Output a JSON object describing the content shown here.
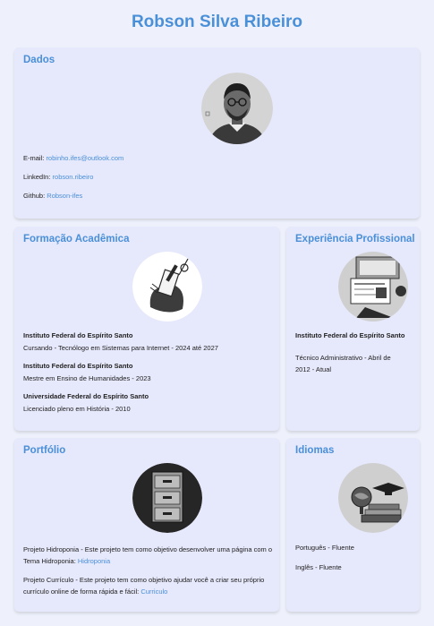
{
  "header": {
    "name": "Robson Silva Ribeiro"
  },
  "dados": {
    "title": "Dados",
    "email_label": "E-mail:",
    "email_value": "robinho.ifes@outlook.com",
    "linkedin_label": "LinkedIn:",
    "linkedin_value": "robson.ribeiro",
    "github_label": "Github:",
    "github_value": "Robson-ifes"
  },
  "formacao": {
    "title": "Formação Acadêmica",
    "items": [
      {
        "institution": "Instituto Federal do Espírito Santo",
        "detail": "Cursando - Tecnólogo em Sistemas para Internet - 2024 até 2027"
      },
      {
        "institution": "Instituto Federal do Espírito Santo",
        "detail": "Mestre em Ensino de Humanidades - 2023"
      },
      {
        "institution": "Universidade Federal do Espírito Santo",
        "detail": "Licenciado pleno em História - 2010"
      }
    ]
  },
  "experiencia": {
    "title": "Experiência Profissional",
    "institution": "Instituto Federal do Espírito Santo",
    "detail": "Técnico Administrativo - Abril de 2012 - Atual"
  },
  "portfolio": {
    "title": "Portfólio",
    "project1_text": "Projeto Hidroponia - Este projeto tem como objetivo desenvolver uma página com o Tema Hidroponia:",
    "project1_link": "Hidroponia",
    "project2_text": "Projeto Currículo - Este projeto tem como objetivo ajudar você a criar seu próprio currículo online de forma rápida e fácil:",
    "project2_link": "Curriculo"
  },
  "idiomas": {
    "title": "Idiomas",
    "items": [
      "Português - Fluente",
      "Inglês - Fluente"
    ]
  },
  "colors": {
    "accent": "#4a90d9",
    "card": "#e6e8fb",
    "background": "#eef1fb"
  },
  "icons": [
    "profile-avatar",
    "education-illustration",
    "work-illustration",
    "file-cabinet-icon",
    "languages-illustration"
  ]
}
